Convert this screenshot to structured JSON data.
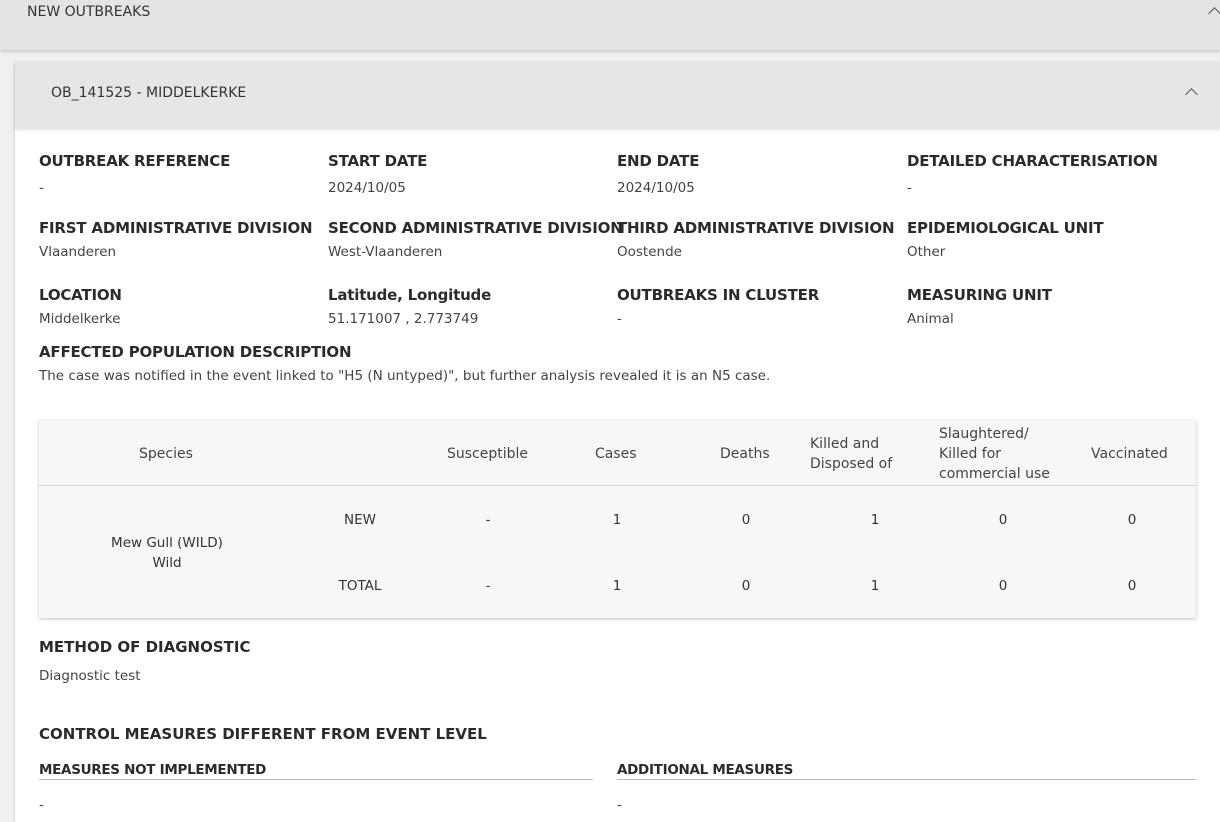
{
  "outer_header": {
    "title": "NEW OUTBREAKS"
  },
  "outbreak": {
    "title": "OB_141525 - MIDDELKERKE",
    "fields": {
      "outbreak_reference": {
        "label": "OUTBREAK REFERENCE",
        "value": "-"
      },
      "start_date": {
        "label": "START DATE",
        "value": "2024/10/05"
      },
      "end_date": {
        "label": "END DATE",
        "value": "2024/10/05"
      },
      "detailed_characterisation": {
        "label": "DETAILED CHARACTERISATION",
        "value": "-"
      },
      "first_admin_division": {
        "label": "FIRST ADMINISTRATIVE DIVISION",
        "value": "Vlaanderen"
      },
      "second_admin_division": {
        "label": "SECOND ADMINISTRATIVE DIVISION",
        "value": "West-Vlaanderen"
      },
      "third_admin_division": {
        "label": "THIRD ADMINISTRATIVE DIVISION",
        "value": "Oostende"
      },
      "epidemiological_unit": {
        "label": "EPIDEMIOLOGICAL UNIT",
        "value": "Other"
      },
      "location": {
        "label": "LOCATION",
        "value": "Middelkerke"
      },
      "lat_long": {
        "label": "Latitude, Longitude",
        "value": "51.171007 , 2.773749"
      },
      "outbreaks_in_cluster": {
        "label": "OUTBREAKS IN CLUSTER",
        "value": "-"
      },
      "measuring_unit": {
        "label": "MEASURING UNIT",
        "value": "Animal"
      },
      "affected_population": {
        "label": "AFFECTED POPULATION DESCRIPTION",
        "value": "The case was notified in the event linked to \"H5 (N untyped)\", but further analysis revealed it is an N5 case."
      }
    },
    "table": {
      "headers": {
        "species": "Species",
        "susceptible": "Susceptible",
        "cases": "Cases",
        "deaths": "Deaths",
        "killed_line1": "Killed and",
        "killed_line2": "Disposed of",
        "slaughtered_line1": "Slaughtered/",
        "slaughtered_line2": "Killed for",
        "slaughtered_line3": "commercial use",
        "vaccinated": "Vaccinated"
      },
      "species_name": "Mew Gull (WILD)",
      "species_type": "Wild",
      "rows": [
        {
          "label": "NEW",
          "susceptible": "-",
          "cases": "1",
          "deaths": "0",
          "killed": "1",
          "slaughtered": "0",
          "vaccinated": "0"
        },
        {
          "label": "TOTAL",
          "susceptible": "-",
          "cases": "1",
          "deaths": "0",
          "killed": "1",
          "slaughtered": "0",
          "vaccinated": "0"
        }
      ]
    },
    "method_of_diagnostic": {
      "label": "METHOD OF DIAGNOSTIC",
      "value": "Diagnostic test"
    },
    "control_measures": {
      "title": "CONTROL MEASURES DIFFERENT FROM EVENT LEVEL",
      "not_implemented": {
        "label": "MEASURES NOT IMPLEMENTED",
        "value": "-"
      },
      "additional": {
        "label": "ADDITIONAL MEASURES",
        "value": "-"
      }
    }
  }
}
